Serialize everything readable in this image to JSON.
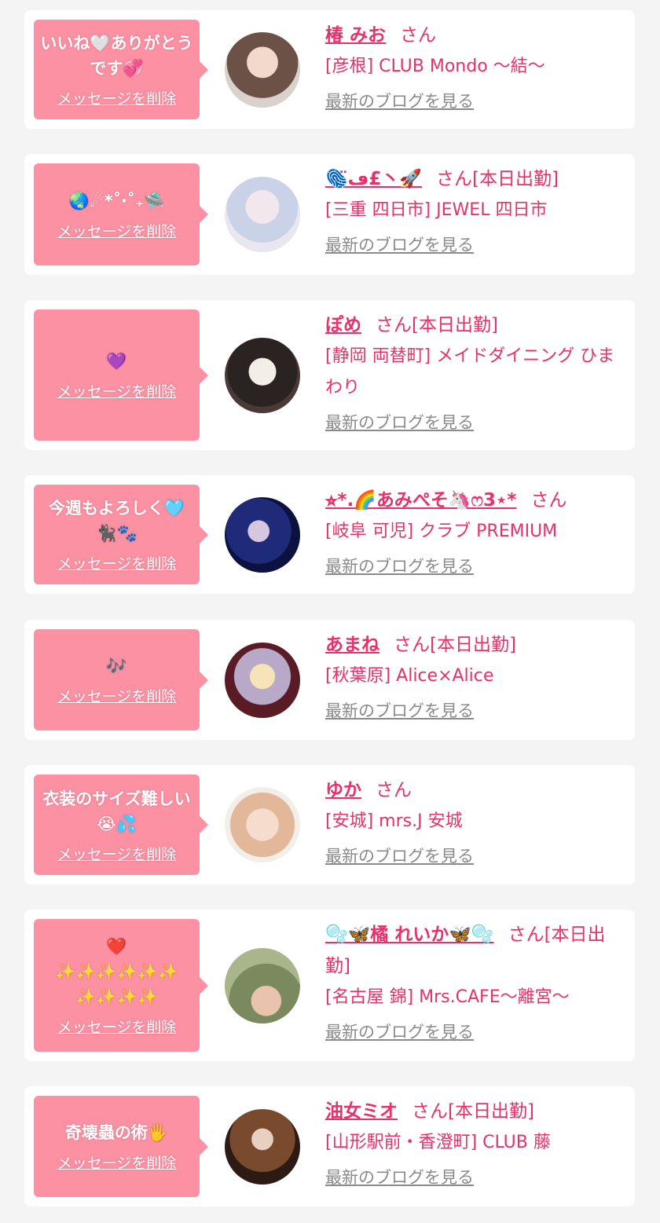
{
  "colors": {
    "page_bg": "#f4f4f4",
    "card_bg": "#ffffff",
    "bubble_bg": "#fb91a3",
    "accent_pink": "#e6316a",
    "link_gray": "#8a8a8a"
  },
  "common": {
    "delete_label": "メッセージを削除",
    "blog_label": "最新のブログを見る"
  },
  "items": [
    {
      "message": "いいね🤍ありがとうです💞",
      "name": "椿 みお",
      "suffix": "さん",
      "shop": "[彦根] CLUB Mondo 〜結〜"
    },
    {
      "message": "🌏☄︎*˚‧˚₊🛸",
      "name": "🫆ڡ̈£丶🚀",
      "suffix": "さん[本日出勤]",
      "shop": "[三重 四日市] JEWEL 四日市"
    },
    {
      "message": "💜",
      "name": "ぽめ",
      "suffix": "さん[本日出勤]",
      "shop": "[静岡 両替町] メイドダイニング ひまわり"
    },
    {
      "message": "今週もよろしく🩵\n🐈‍⬛🐾",
      "name": "⭐︎*.🌈あみぺそ🦄ෆ3⋆*",
      "suffix": "さん",
      "shop": "[岐阜 可児] クラブ PREMIUM"
    },
    {
      "message": "🎶",
      "name": "あまね",
      "suffix": "さん[本日出勤]",
      "shop": "[秋葉原] Alice×Alice"
    },
    {
      "message": "衣装のサイズ難しい😭💦",
      "name": "ゆか",
      "suffix": "さん",
      "shop": "[安城] mrs.J 安城"
    },
    {
      "message": "❤️\n✨✨✨✨✨✨\n✨✨✨✨",
      "name": "🫧🦋橘 れいか🦋🫧",
      "suffix": "さん[本日出勤]",
      "shop": "[名古屋 錦] Mrs.CAFE〜離宮〜"
    },
    {
      "message": "奇壊蟲の術🖐",
      "name": "油女ミオ",
      "suffix": "さん[本日出勤]",
      "shop": "[山形駅前・香澄町] CLUB 藤"
    }
  ]
}
